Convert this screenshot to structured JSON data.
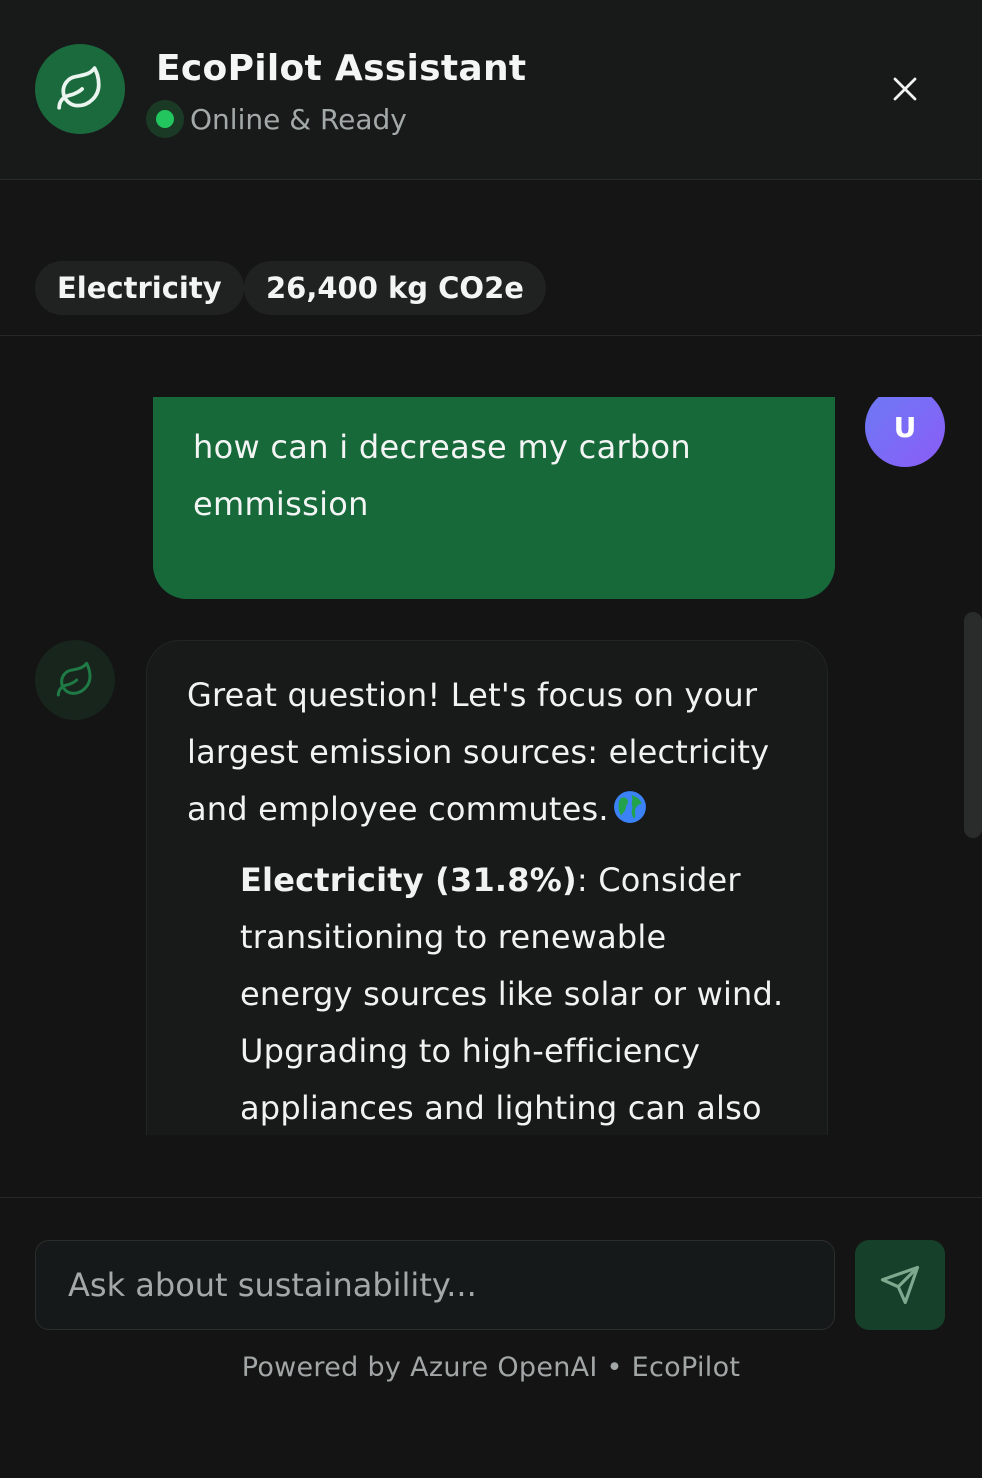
{
  "header": {
    "title": "EcoPilot Assistant",
    "status": "Online & Ready",
    "logo_icon": "leaf-icon",
    "close_icon": "close-icon"
  },
  "context_chips": [
    {
      "label": "Electricity"
    },
    {
      "label": "26,400 kg CO2e"
    }
  ],
  "messages": {
    "user": {
      "avatar_initial": "U",
      "text": "how can i decrease my carbon emmission"
    },
    "assistant": {
      "avatar_icon": "leaf-icon",
      "intro": "Great question! Let's focus on your largest emission sources: electricity and employee commutes.",
      "intro_emoji": "globe-icon",
      "bullets": [
        {
          "title": "Electricity (31.8%)",
          "text": ": Consider transitioning to renewable energy sources like solar or wind. Upgrading to high-efficiency appliances and lighting can also"
        }
      ]
    }
  },
  "composer": {
    "placeholder": "Ask about sustainability...",
    "send_icon": "send-icon"
  },
  "footer": {
    "text": "Powered by Azure OpenAI • EcoPilot"
  },
  "colors": {
    "background": "#141414",
    "accent_green": "#17693a",
    "status_green": "#22c55e",
    "user_avatar": "#7c6ff6"
  }
}
